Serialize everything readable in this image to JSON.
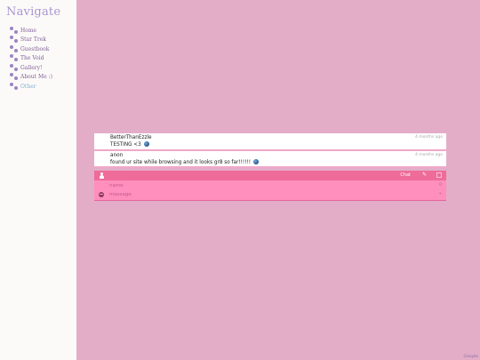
{
  "nav": {
    "title": "Navigate",
    "items": [
      {
        "label": "Home"
      },
      {
        "label": "Star Trek"
      },
      {
        "label": "Guestbook"
      },
      {
        "label": "The Void"
      },
      {
        "label": "Gallery!"
      },
      {
        "label": "About Me :)"
      },
      {
        "label": "Other"
      }
    ]
  },
  "comments": [
    {
      "author": "BetterThanEzzle",
      "text": "TESTING <3",
      "time": "4 months ago"
    },
    {
      "author": "anon",
      "text": "found ur site while browsing and it looks gr8 so far!!!!!!",
      "time": "4 months ago"
    }
  ],
  "chatbox": {
    "chat_label": "Chat",
    "edit_icon": "edit-icon",
    "name_placeholder": "name",
    "message_placeholder": "message",
    "name_suffix": "0",
    "message_suffix": "+"
  },
  "credit": "Ginaybo",
  "colors": {
    "background": "#e4adc7",
    "sidebar": "#fcfaf9",
    "accent": "#ef6b99",
    "form": "#ff8fbd",
    "nav_title": "#a596cf"
  }
}
